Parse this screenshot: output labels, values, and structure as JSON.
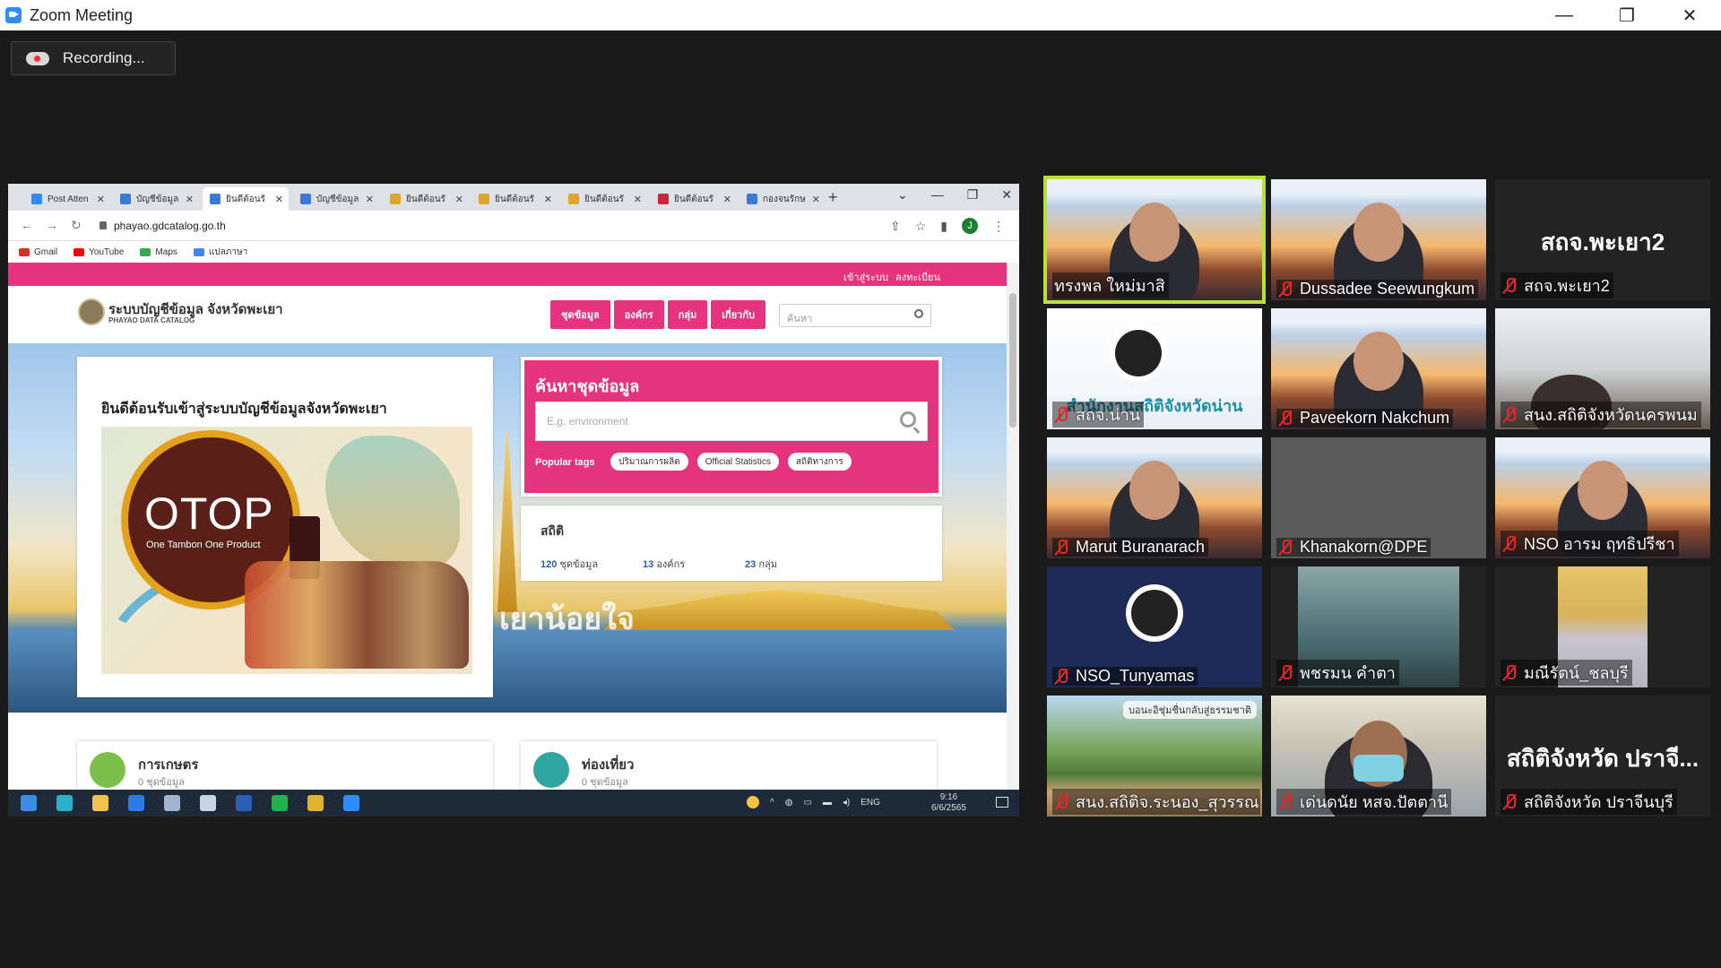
{
  "window": {
    "title": "Zoom Meeting",
    "minimize": "—",
    "restore": "❐",
    "close": "✕"
  },
  "recording": {
    "label": "Recording..."
  },
  "browser": {
    "tabs": [
      {
        "label": "Post Atten",
        "color": "#2d8cff"
      },
      {
        "label": "บัญชีข้อมูล",
        "color": "#3b7bd8"
      },
      {
        "label": "ยินดีต้อนรั",
        "color": "#3b7bd8"
      },
      {
        "label": "บัญชีข้อมูล",
        "color": "#3b7bd8"
      },
      {
        "label": "ยินดีต้อนรั",
        "color": "#e0a62b"
      },
      {
        "label": "ยินดีต้อนรั",
        "color": "#e0a62b"
      },
      {
        "label": "ยินดีต้อนรั",
        "color": "#e0a62b"
      },
      {
        "label": "ยินดีต้อนรั",
        "color": "#c8283c"
      },
      {
        "label": "กองจนรักษ",
        "color": "#3b7bd8"
      }
    ],
    "close_glyph": "✕",
    "new_tab": "+",
    "controls": [
      "⌄",
      "—",
      "❐",
      "✕"
    ],
    "url": "phayao.gdcatalog.go.th",
    "profile_initial": "J",
    "bookmarks": [
      {
        "label": "Gmail",
        "color": "#d93025"
      },
      {
        "label": "YouTube",
        "color": "#ff0000"
      },
      {
        "label": "Maps",
        "color": "#34a853"
      },
      {
        "label": "แปลภาษา",
        "color": "#4285f4"
      }
    ]
  },
  "site": {
    "login": "เข้าสู่ระบบ",
    "register": "ลงทะเบียน",
    "name": "ระบบบัญชีข้อมูล จังหวัดพะเยา",
    "subname": "PHAYAO DATA CATALOG",
    "menu": [
      "ชุดข้อมูล",
      "องค์กร",
      "กลุ่ม",
      "เกี่ยวกับ"
    ],
    "search_placeholder": "ค้นหา",
    "welcome": "ยินดีต้อนรับเข้าสู่ระบบบัญชีข้อมูลจังหวัดพะเยา",
    "otop_logo": "OTOP",
    "otop_sub": "One Tambon One Product",
    "hero_banner": "เยาน้อยใจ",
    "search_title": "ค้นหาชุดข้อมูล",
    "search_input_placeholder": "E.g. environment",
    "popular_tags_label": "Popular tags",
    "tags": [
      "ปริมาณการผลิต",
      "Official Statistics",
      "สถิติทางการ"
    ],
    "stats_title": "สถิติ",
    "stats": [
      {
        "num": "120",
        "label": "ชุดข้อมูล"
      },
      {
        "num": "13",
        "label": "องค์กร"
      },
      {
        "num": "23",
        "label": "กลุ่ม"
      }
    ],
    "categories": [
      {
        "name": "การเกษตร",
        "count": "0 ชุดข้อมูล",
        "color": "#7cc04b"
      },
      {
        "name": "ท่องเที่ยว",
        "count": "0 ชุดข้อมูล",
        "color": "#2fa7a0"
      }
    ]
  },
  "taskbar": {
    "lang": "ENG",
    "time": "9:16",
    "date": "6/6/2565"
  },
  "participants": [
    {
      "name": "ทรงพล ใหม่มาสิ",
      "muted": false,
      "active": true,
      "bg": "city"
    },
    {
      "name": "Dussadee Seewungkum",
      "muted": true,
      "active": false,
      "bg": "city"
    },
    {
      "name": "สถจ.พะเยา2",
      "muted": true,
      "active": false,
      "bg": "text",
      "big": "สถจ.พะเยา2"
    },
    {
      "name": "สถจ.น่าน",
      "muted": true,
      "active": false,
      "bg": "nan",
      "caption": "สำนักงานสถิติจังหวัดน่าน"
    },
    {
      "name": "Paveekorn Nakchum",
      "muted": true,
      "active": false,
      "bg": "city"
    },
    {
      "name": "สนง.สถิติจังหวัดนครพนม",
      "muted": true,
      "active": false,
      "bg": "office"
    },
    {
      "name": "Marut Buranarach",
      "muted": true,
      "active": false,
      "bg": "city"
    },
    {
      "name": "Khanakorn@DPE",
      "muted": true,
      "active": false,
      "bg": "gray"
    },
    {
      "name": "NSO อารม  ฤทธิปรีชา",
      "muted": true,
      "active": false,
      "bg": "city"
    },
    {
      "name": "NSO_Tunyamas",
      "muted": true,
      "active": false,
      "bg": "obs"
    },
    {
      "name": "พชรมน คำตา",
      "muted": true,
      "active": false,
      "bg": "blur"
    },
    {
      "name": "มณีรัตน์_ชลบุรี",
      "muted": true,
      "active": false,
      "bg": "curtain"
    },
    {
      "name": "สนง.สถิติจ.ระนอง_สุวรรณา",
      "muted": true,
      "active": false,
      "bg": "beach",
      "caption": "บอนะอิชุ่มชื่นกลับสู่ธรรมชาติ"
    },
    {
      "name": "เด่นดนัย หสจ.ปัตตานี",
      "muted": true,
      "active": false,
      "bg": "mask"
    },
    {
      "name": "สถิติจังหวัด ปราจีนบุรี",
      "muted": true,
      "active": false,
      "bg": "text",
      "big": "สถิติจังหวัด ปราจี..."
    }
  ],
  "colors": {
    "accent_pink": "#e5337e",
    "active_speaker": "#b8e03a",
    "mute_red": "#e02828"
  }
}
